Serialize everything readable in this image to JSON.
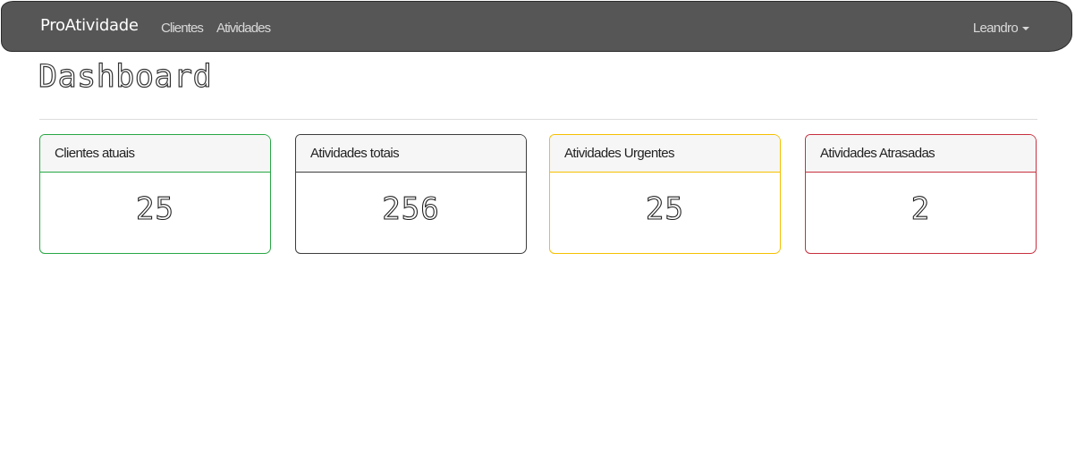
{
  "navbar": {
    "brand": "ProAtividade",
    "links": [
      {
        "label": "Clientes"
      },
      {
        "label": "Atividades"
      }
    ],
    "user": {
      "label": "Leandro",
      "icon": "caret-down-icon"
    }
  },
  "page": {
    "title": "Dashboard"
  },
  "cards": [
    {
      "title": "Clientes atuais",
      "value": "25",
      "color": "#28a745"
    },
    {
      "title": "Atividades totais",
      "value": "256",
      "color": "#3d3d3d"
    },
    {
      "title": "Atividades Urgentes",
      "value": "25",
      "color": "#f5c000"
    },
    {
      "title": "Atividades Atrasadas",
      "value": "2",
      "color": "#c8303e"
    }
  ],
  "colors": {
    "navbar_bg": "#565656",
    "navbar_text": "#ffffff",
    "card_header_bg": "#f6f6f6"
  }
}
